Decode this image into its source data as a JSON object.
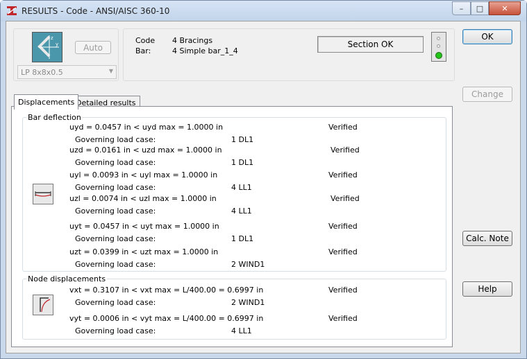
{
  "window": {
    "title": "RESULTS - Code - ANSI/AISC 360-10"
  },
  "titlebar_buttons": {
    "minimize": "–",
    "maximize": "□",
    "close": "✕"
  },
  "section": {
    "auto_label": "Auto",
    "selected": "LP 8x8x0.5",
    "axis_z": "z",
    "axis_y": "y"
  },
  "info": {
    "code_label": "Code",
    "code_value": "4  Bracings",
    "bar_label": "Bar:",
    "bar_value": "4  Simple bar_1_4",
    "status": "Section OK"
  },
  "buttons": {
    "ok": "OK",
    "change": "Change",
    "calc_note": "Calc. Note",
    "help": "Help"
  },
  "tabs": [
    "Displacements",
    "Detailed results"
  ],
  "bar_deflection": {
    "title": "Bar deflection",
    "rows": [
      {
        "check": "uyd = 0.0457 in  <  uyd max = 1.0000 in",
        "status": "Verified",
        "gov_label": "Governing load case:",
        "gov_value": "1 DL1"
      },
      {
        "check": "uzd = 0.0161 in  <  uzd max = 1.0000 in",
        "status": "Verified",
        "gov_label": "Governing load case:",
        "gov_value": "1 DL1"
      },
      {
        "check": "uyl = 0.0093 in  <  uyl max = 1.0000 in",
        "status": "Verified",
        "gov_label": "Governing load case:",
        "gov_value": "4 LL1"
      },
      {
        "check": "uzl = 0.0074 in  <  uzl max = 1.0000 in",
        "status": "Verified",
        "gov_label": "Governing load case:",
        "gov_value": "4 LL1"
      },
      {
        "check": "uyt = 0.0457 in  <  uyt max = 1.0000 in",
        "status": "Verified",
        "gov_label": "Governing load case:",
        "gov_value": "1 DL1"
      },
      {
        "check": "uzt = 0.0399 in  <  uzt max = 1.0000 in",
        "status": "Verified",
        "gov_label": "Governing load case:",
        "gov_value": "2 WIND1"
      }
    ]
  },
  "node_displacements": {
    "title": "Node displacements",
    "rows": [
      {
        "check": "vxt = 0.3107 in  <  vxt max = L/400.00 = 0.6997 in",
        "status": "Verified",
        "gov_label": "Governing load case:",
        "gov_value": "2 WIND1"
      },
      {
        "check": "vyt = 0.0006 in  <  vyt max = L/400.00 = 0.6997 in",
        "status": "Verified",
        "gov_label": "Governing load case:",
        "gov_value": "4 LL1"
      }
    ]
  },
  "colors": {
    "titlebar": "#c9d8ea",
    "light_green": "#22c51a",
    "close_red": "#c6513a"
  }
}
